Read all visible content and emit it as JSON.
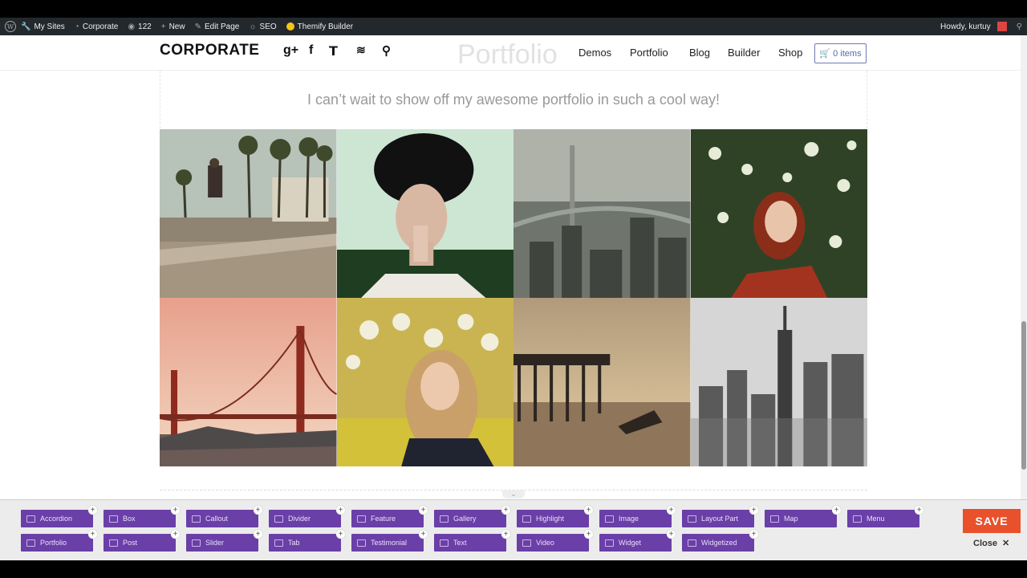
{
  "admin_bar": {
    "items": [
      {
        "label": "My Sites",
        "icon": "wrench-icon"
      },
      {
        "label": "Corporate",
        "icon": "dashboard-icon"
      },
      {
        "label": "122",
        "icon": "comment-icon"
      },
      {
        "label": "New",
        "icon": "plus-icon"
      },
      {
        "label": "Edit Page",
        "icon": "pencil-icon"
      },
      {
        "label": "SEO",
        "icon": "seo-icon"
      },
      {
        "label": "Themify Builder",
        "icon": "themify-icon"
      }
    ],
    "howdy": "Howdy, kurtuy"
  },
  "header": {
    "logo": "CORPORATE",
    "social": [
      "google-plus-icon",
      "facebook-icon",
      "twitter-icon",
      "rss-icon",
      "search-icon"
    ],
    "ghost_title": "Portfolio",
    "nav": [
      "Demos",
      "Portfolio",
      "Blog",
      "Builder",
      "Shop"
    ],
    "cart": "0 items"
  },
  "page": {
    "subtitle": "I can’t wait to show off my awesome portfolio in such a cool way!"
  },
  "builder": {
    "row1": [
      "Accordion",
      "Box",
      "Callout",
      "Divider",
      "Feature",
      "Gallery",
      "Highlight",
      "Image",
      "Layout Part",
      "Map",
      "Menu"
    ],
    "row2": [
      "Portfolio",
      "Post",
      "Slider",
      "Tab",
      "Testimonial",
      "Text",
      "Video",
      "Widget",
      "Widgetized"
    ],
    "save": "SAVE",
    "close": "Close"
  },
  "colors": {
    "module_bg": "#6a3fa8",
    "save_bg": "#e8512b",
    "admin_bar_bg": "#23282d",
    "cart_accent": "#5868a8"
  }
}
